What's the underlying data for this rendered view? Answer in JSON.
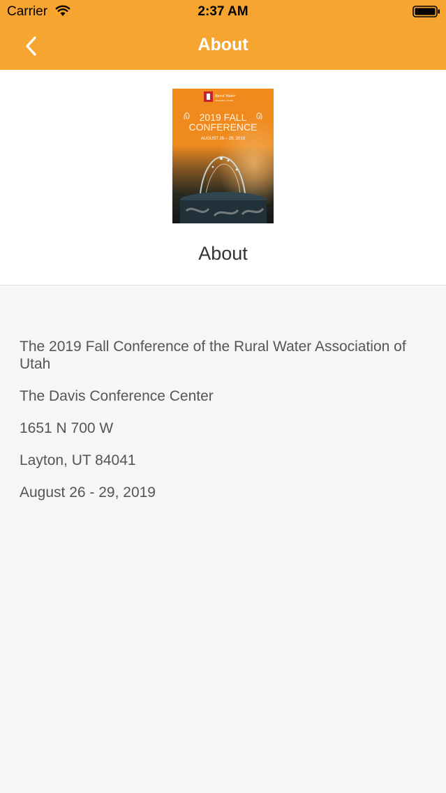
{
  "status_bar": {
    "carrier": "Carrier",
    "time": "2:37 AM"
  },
  "nav": {
    "title": "About",
    "back_icon": "chevron-left-icon"
  },
  "header": {
    "poster": {
      "org_name": "Rural Water",
      "org_subtitle": "Association of Utah",
      "line1": "2019 FALL",
      "line2": "CONFERENCE",
      "dates": "AUGUST 26 – 29, 2019"
    },
    "heading": "About"
  },
  "details": [
    "The 2019 Fall Conference of the Rural Water Association of Utah",
    "The Davis Conference Center",
    "1651 N 700 W",
    "Layton, UT 84041",
    "August 26 - 29, 2019"
  ],
  "colors": {
    "accent": "#f6a531",
    "background": "#f6f6f8",
    "text": "#555555"
  }
}
